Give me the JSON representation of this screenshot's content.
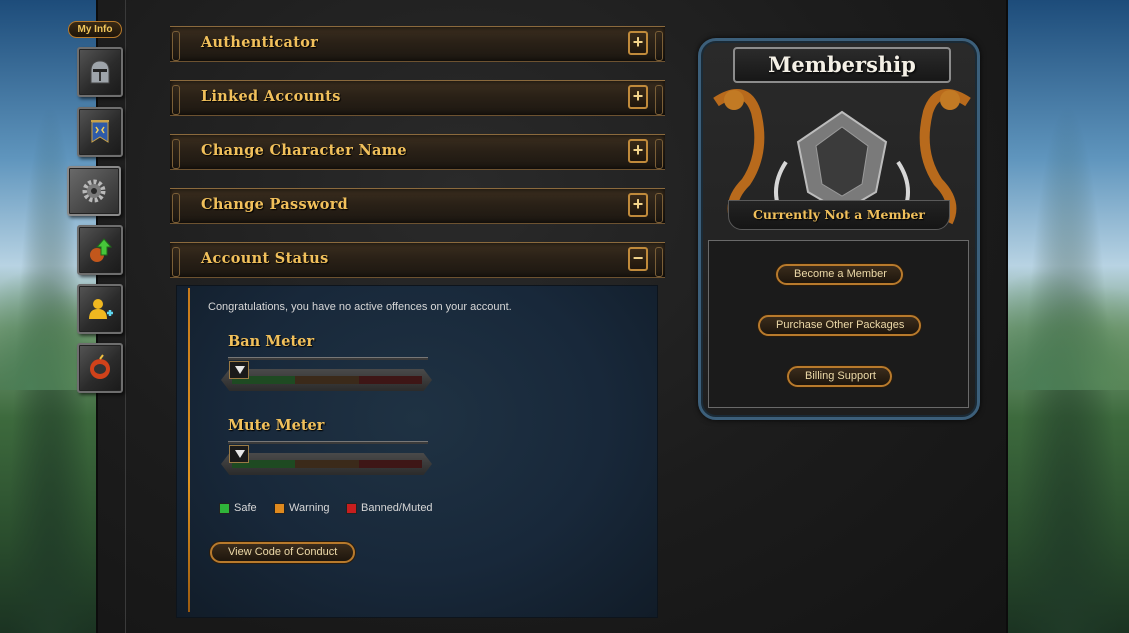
{
  "nav": {
    "my_info_label": "My Info",
    "buttons": [
      {
        "name": "helmet-icon"
      },
      {
        "name": "banner-icon"
      },
      {
        "name": "gear-icon"
      },
      {
        "name": "upgrade-arrow-icon"
      },
      {
        "name": "add-friend-icon"
      },
      {
        "name": "bomb-icon"
      }
    ]
  },
  "accordion": {
    "sections": [
      {
        "title": "Authenticator",
        "toggle": "+"
      },
      {
        "title": "Linked Accounts",
        "toggle": "+"
      },
      {
        "title": "Change Character Name",
        "toggle": "+"
      },
      {
        "title": "Change Password",
        "toggle": "+"
      },
      {
        "title": "Account Status",
        "toggle": "−"
      }
    ]
  },
  "account_status": {
    "message": "Congratulations, you have no active offences on your account.",
    "ban_meter": {
      "title": "Ban Meter",
      "level": 0
    },
    "mute_meter": {
      "title": "Mute Meter",
      "level": 0
    },
    "legend": {
      "safe": "Safe",
      "warning": "Warning",
      "banned": "Banned/Muted"
    },
    "conduct_button": "View Code of Conduct"
  },
  "membership": {
    "title": "Membership",
    "status": "Currently Not a Member",
    "buttons": {
      "become": "Become a Member",
      "packages": "Purchase Other Packages",
      "billing": "Billing Support"
    }
  },
  "colors": {
    "accent_gold": "#f1c05b",
    "safe": "#2fb43a",
    "warning": "#e08a1e",
    "banned": "#c81e1e",
    "frame_blue": "#3c5f7a"
  }
}
